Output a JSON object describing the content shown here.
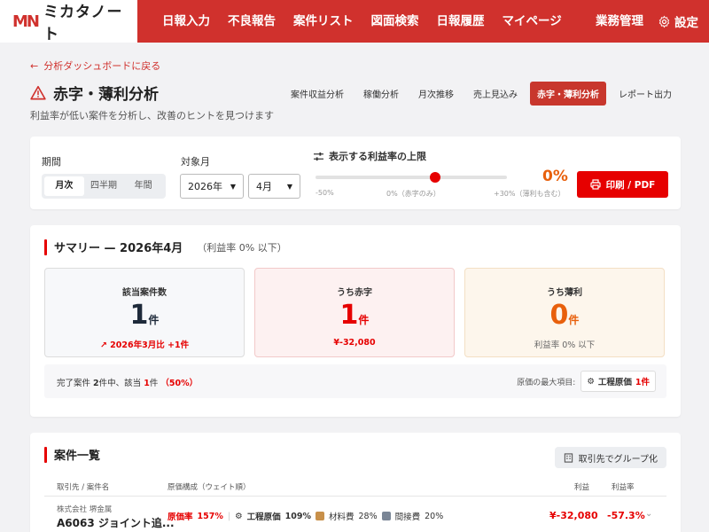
{
  "brand": {
    "name": "ミカタノート",
    "mark": "MN",
    "accent": "#d0312d",
    "primary_red": "#e60000"
  },
  "nav": {
    "items": [
      "日報入力",
      "不良報告",
      "案件リスト",
      "図面検索",
      "日報履歴",
      "マイページ"
    ],
    "right": {
      "admin": "業務管理",
      "settings": "設定"
    }
  },
  "back_link": "分析ダッシュボードに戻る",
  "page": {
    "title": "赤字・薄利分析",
    "subtitle": "利益率が低い案件を分析し、改善のヒントを見つけます",
    "title_icon": "warning-triangle-icon"
  },
  "tabs": [
    "案件収益分析",
    "稼働分析",
    "月次推移",
    "売上見込み",
    "赤字・薄利分析",
    "レポート出力"
  ],
  "active_tab": "赤字・薄利分析",
  "filters": {
    "period_label": "期間",
    "period_options": [
      "月次",
      "四半期",
      "年間"
    ],
    "period_selected": "月次",
    "month_label": "対象月",
    "year_value": "2026年",
    "month_value": "4月",
    "threshold_label": "表示する利益率の上限",
    "threshold_value": "0%",
    "threshold_fraction": 0.625,
    "threshold_ticks": [
      "-50%",
      "0%（赤字のみ）",
      "+30%（薄利も含む）"
    ],
    "print_label": "印刷 / PDF"
  },
  "summary": {
    "title": "サマリー — 2026年4月",
    "note": "（利益率 0% 以下）",
    "boxes": {
      "target": {
        "label": "該当案件数",
        "value": "1",
        "unit": "件",
        "sub": "2026年3月比 +1件"
      },
      "loss": {
        "label": "うち赤字",
        "value": "1",
        "unit": "件",
        "sub": "¥-32,080"
      },
      "thin": {
        "label": "うち薄利",
        "value": "0",
        "unit": "件",
        "sub": "利益率 0% 以下"
      }
    },
    "info": {
      "prefix": "完了案件",
      "done_count": "2",
      "mid": "件中、該当",
      "hit_count": "1",
      "unit": "件",
      "ratio": "（50%）",
      "max_cost_label": "原価の最大項目:",
      "max_cost_item": "工程原価",
      "max_cost_count": "1件"
    }
  },
  "list": {
    "title": "案件一覧",
    "group_button": "取引先でグループ化",
    "headers": {
      "client": "取引先 / 案件名",
      "cost": "原価構成（ウェイト順）",
      "profit": "利益",
      "rate": "利益率"
    },
    "rows": [
      {
        "client": "株式会社 堺金属",
        "name": "A6063 ジョイント追...",
        "cost_rate_label": "原価率",
        "cost_rate": "157%",
        "cost_items": [
          {
            "name": "工程原価",
            "pct": "109%"
          },
          {
            "name": "材料費",
            "pct": "28%"
          },
          {
            "name": "間接費",
            "pct": "20%"
          }
        ],
        "profit": "¥-32,080",
        "rate": "-57.3%"
      }
    ]
  }
}
